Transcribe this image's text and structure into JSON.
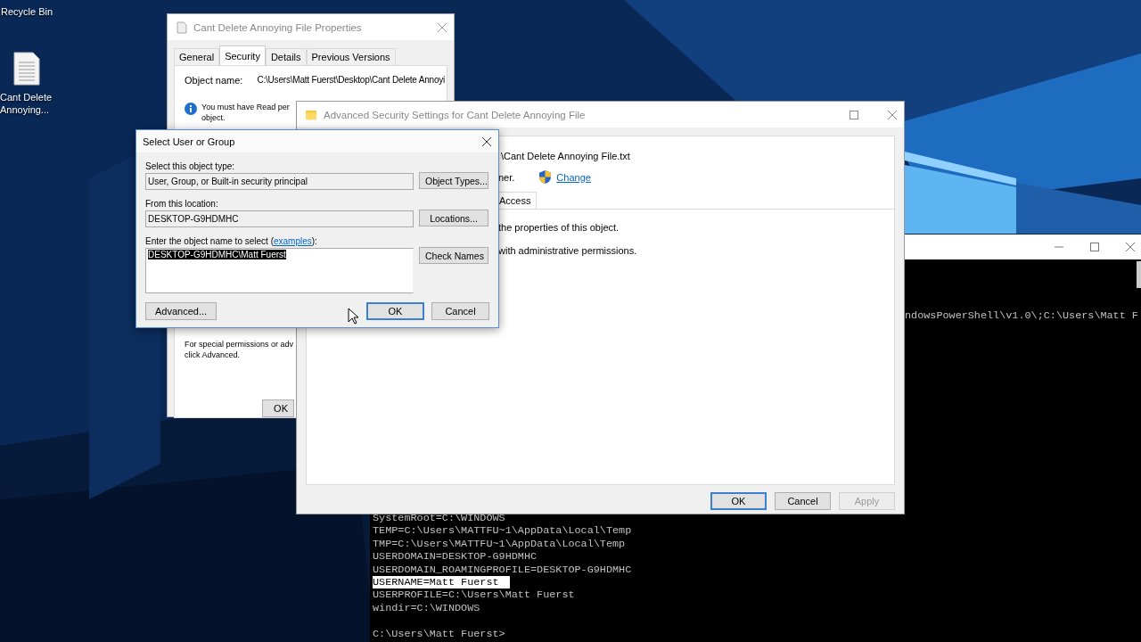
{
  "desktop": {
    "recycle_bin_label": "Recycle Bin",
    "file_label": "Cant Delete Annoying..."
  },
  "properties_window": {
    "title": "Cant Delete Annoying File Properties",
    "tabs": [
      {
        "label": "General",
        "selected": false
      },
      {
        "label": "Security",
        "selected": true
      },
      {
        "label": "Details",
        "selected": false
      },
      {
        "label": "Previous Versions",
        "selected": false
      }
    ],
    "object_name_label": "Object name:",
    "object_name": "C:\\Users\\Matt Fuerst\\Desktop\\Cant Delete Annoyi",
    "info_lines": [
      "You must have Read per",
      "object."
    ],
    "hint_lines": [
      "For special permissions or adv",
      "click Advanced."
    ],
    "ok_button": "OK"
  },
  "console": {
    "top_line": "ndowsPowerShell\\v1.0\\;C:\\Users\\Matt F",
    "lines": [
      {
        "text": "SystemRoot=C:\\WINDOWS",
        "selected": false
      },
      {
        "text": "TEMP=C:\\Users\\MATTFU~1\\AppData\\Local\\Temp",
        "selected": false
      },
      {
        "text": "TMP=C:\\Users\\MATTFU~1\\AppData\\Local\\Temp",
        "selected": false
      },
      {
        "text": "USERDOMAIN=DESKTOP-G9HDMHC",
        "selected": false
      },
      {
        "text": "USERDOMAIN_ROAMINGPROFILE=DESKTOP-G9HDMHC",
        "selected": false
      },
      {
        "text": "USERNAME=Matt Fuerst",
        "selected": true
      },
      {
        "text": "USERPROFILE=C:\\Users\\Matt Fuerst",
        "selected": false
      },
      {
        "text": "windir=C:\\WINDOWS",
        "selected": false
      }
    ],
    "prompt": "C:\\Users\\Matt Fuerst>"
  },
  "advanced_window": {
    "title": "Advanced Security Settings for Cant Delete Annoying File",
    "file_path": "\\Cant Delete Annoying File.txt",
    "owner_text": "ner.",
    "change_link": "Change",
    "tab": "Access",
    "lines": [
      "the properties of this object.",
      "with administrative permissions."
    ],
    "buttons": [
      {
        "label": "OK",
        "default": true,
        "disabled": false
      },
      {
        "label": "Cancel",
        "default": false,
        "disabled": false
      },
      {
        "label": "Apply",
        "default": false,
        "disabled": true
      }
    ]
  },
  "select_dialog": {
    "title": "Select User or Group",
    "object_type_label": "Select this object type:",
    "object_type": "User, Group, or Built-in security principal",
    "object_types_button": "Object Types...",
    "location_label": "From this location:",
    "location": "DESKTOP-G9HDMHC",
    "locations_button": "Locations...",
    "name_label_before": "Enter the object name to select (",
    "name_label_link": "examples",
    "name_label_after": "):",
    "name_value": "DESKTOP-G9HDMHC\\Matt Fuerst",
    "name_selected": true,
    "check_names_button": "Check Names",
    "buttons": [
      {
        "label": "Advanced...",
        "default": false,
        "disabled": false
      },
      {
        "label": "OK",
        "default": true,
        "disabled": false
      },
      {
        "label": "Cancel",
        "default": false,
        "disabled": false
      }
    ]
  }
}
